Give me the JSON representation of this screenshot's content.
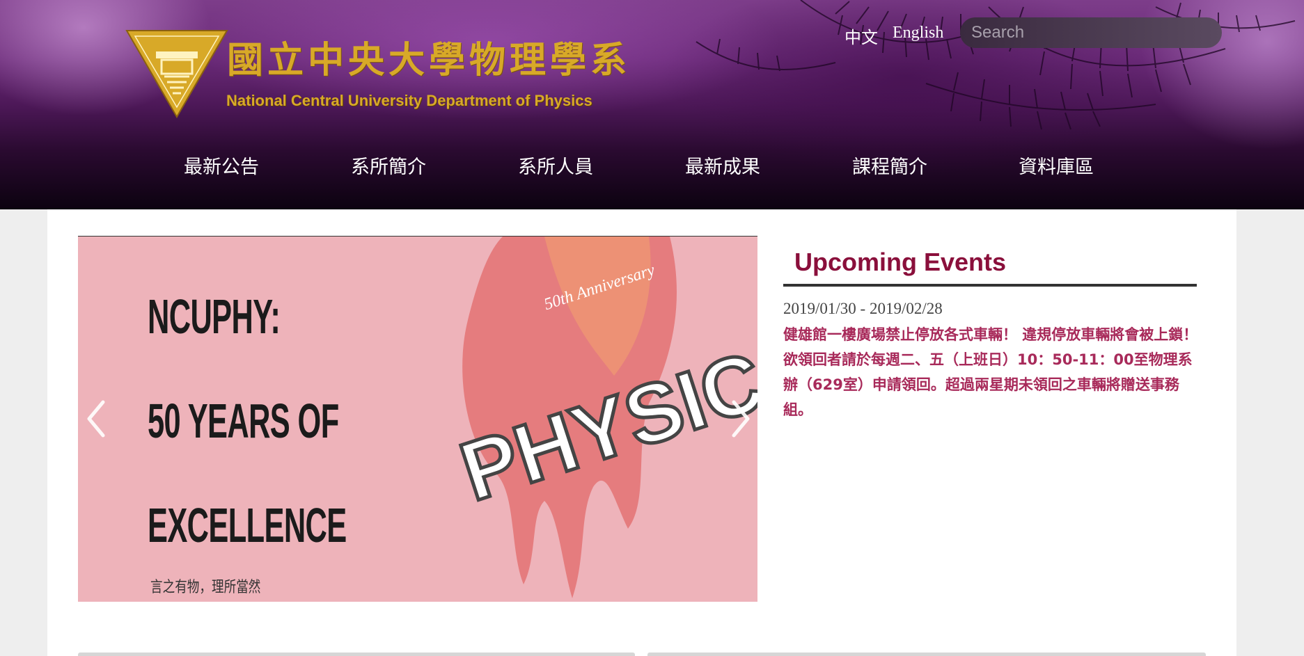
{
  "header": {
    "logo_cn": "國立中央大學物理學系",
    "logo_en": "National Central University Department of Physics",
    "lang_zh": "中文",
    "lang_en": "English",
    "search_placeholder": "Search"
  },
  "nav": {
    "items": [
      "最新公告",
      "系所簡介",
      "系所人員",
      "最新成果",
      "課程簡介",
      "資料庫區"
    ]
  },
  "slider": {
    "title_lines": [
      "NCUPHY:",
      "50 YEARS OF",
      "EXCELLENCE"
    ],
    "subtitle": "言之有物，理所當然",
    "art_word": "PHYSICS",
    "art_badge": "50th Anniversary"
  },
  "events": {
    "heading": "Upcoming Events",
    "items": [
      {
        "date": "2019/01/30 - 2019/02/28",
        "text": "健雄館一樓廣場禁止停放各式車輛！ 違規停放車輛將會被上鎖！欲領回者請於每週二、五（上班日）10：50-11：00至物理系辦（629室）申請領回。超過兩星期未領回之車輛將贈送事務組。"
      }
    ]
  },
  "colors": {
    "accent": "#8a0f3b",
    "event_link": "#a82a5a",
    "logo_gold": "#d8a928",
    "slide_bg": "#eeb3ba"
  }
}
